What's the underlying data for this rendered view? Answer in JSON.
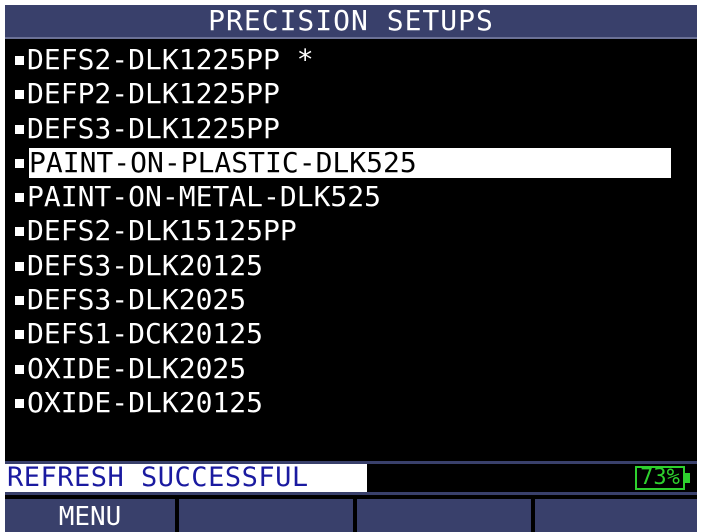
{
  "title": "PRECISION SETUPS",
  "setups": [
    {
      "label": "DEFS2-DLK1225PP  *",
      "selected": false
    },
    {
      "label": "DEFP2-DLK1225PP",
      "selected": false
    },
    {
      "label": "DEFS3-DLK1225PP",
      "selected": false
    },
    {
      "label": "PAINT-ON-PLASTIC-DLK525",
      "selected": true
    },
    {
      "label": "PAINT-ON-METAL-DLK525",
      "selected": false
    },
    {
      "label": "DEFS2-DLK15125PP",
      "selected": false
    },
    {
      "label": "DEFS3-DLK20125",
      "selected": false
    },
    {
      "label": "DEFS3-DLK2025",
      "selected": false
    },
    {
      "label": "DEFS1-DCK20125",
      "selected": false
    },
    {
      "label": "OXIDE-DLK2025",
      "selected": false
    },
    {
      "label": "OXIDE-DLK20125",
      "selected": false
    }
  ],
  "status": {
    "message": "REFRESH SUCCESSFUL",
    "battery": "73%"
  },
  "softkeys": [
    "MENU",
    "",
    "",
    ""
  ],
  "colors": {
    "bar": "#39406b",
    "battery": "#2ed12e",
    "status_text": "#1a1aa0"
  }
}
